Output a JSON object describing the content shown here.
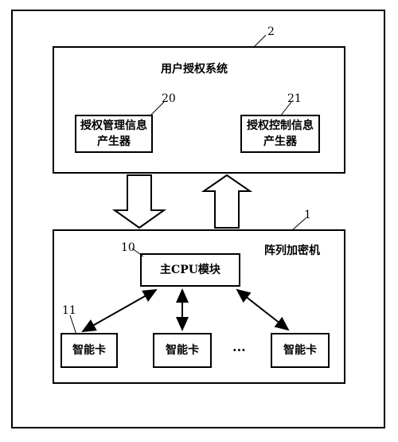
{
  "system": {
    "ref": "2",
    "title": "用户授权系统"
  },
  "auth_manage": {
    "ref": "20",
    "line1": "授权管理信息",
    "line2": "产生器"
  },
  "auth_control": {
    "ref": "21",
    "line1": "授权控制信息",
    "line2": "产生器"
  },
  "array": {
    "ref": "1",
    "title": "阵列加密机"
  },
  "cpu": {
    "ref": "10",
    "label": "主CPU模块"
  },
  "cards": {
    "ref": "11",
    "items": [
      "智能卡",
      "智能卡",
      "智能卡"
    ],
    "ellipsis": "···"
  }
}
